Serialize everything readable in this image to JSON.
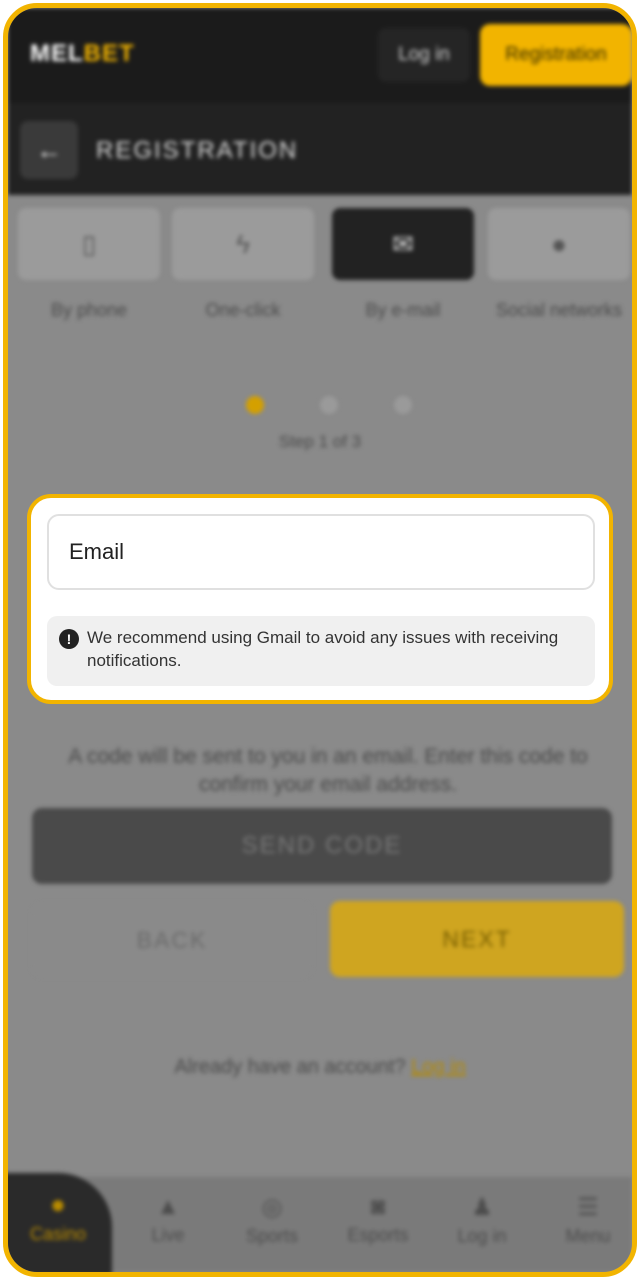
{
  "header": {
    "logo_main": "MEL",
    "logo_accent": "BET",
    "login_label": "Log in",
    "register_label": "Registration"
  },
  "subheader": {
    "title": "REGISTRATION"
  },
  "tabs": [
    {
      "label": "By phone",
      "icon": "phone-icon"
    },
    {
      "label": "One-click",
      "icon": "lightning-icon"
    },
    {
      "label": "By e-mail",
      "icon": "envelope-icon"
    },
    {
      "label": "Social networks",
      "icon": "social-icon"
    }
  ],
  "steps": {
    "text": "Step 1 of 3",
    "current": 1,
    "total": 3
  },
  "form": {
    "email_placeholder": "Email",
    "notice_text": "We recommend using Gmail to avoid any issues with receiving notifications."
  },
  "code_note": "A code will be sent to you in an email. Enter this code to confirm your email address.",
  "buttons": {
    "send_code": "SEND CODE",
    "back": "BACK",
    "next": "NEXT"
  },
  "account": {
    "prompt": "Already have an account?",
    "link": "Log in"
  },
  "bottom_nav": [
    {
      "label": "Casino",
      "icon": "casino-icon"
    },
    {
      "label": "Live",
      "icon": "live-icon"
    },
    {
      "label": "Sports",
      "icon": "sports-icon"
    },
    {
      "label": "Esports",
      "icon": "gamepad-icon"
    },
    {
      "label": "Log in",
      "icon": "user-icon"
    },
    {
      "label": "Menu",
      "icon": "menu-icon"
    }
  ],
  "colors": {
    "accent": "#f2b400",
    "dark": "#1b1b1b"
  }
}
